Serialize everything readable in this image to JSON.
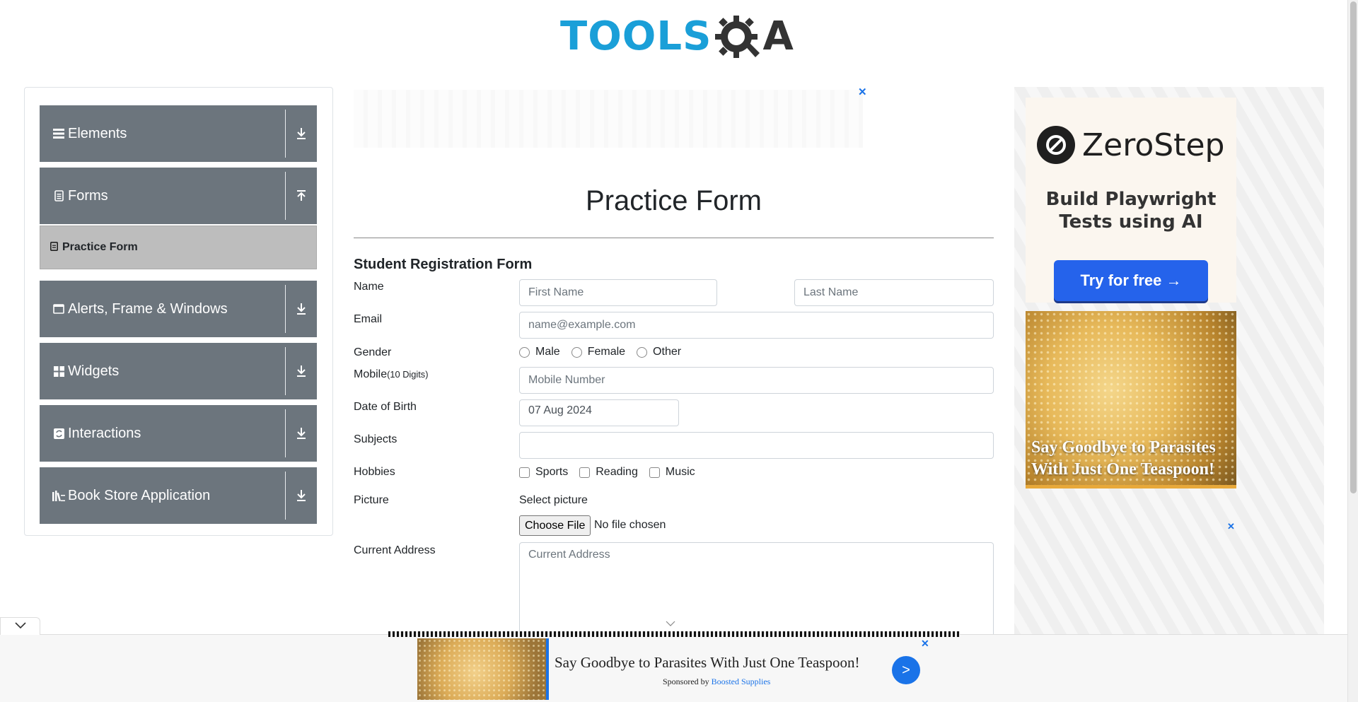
{
  "header": {
    "logo_text": "TOOLS",
    "logo_suffix": "A"
  },
  "sidebar": {
    "groups": [
      {
        "label": "Elements",
        "icon": "menu-icon",
        "toggle": "download-icon"
      },
      {
        "label": "Forms",
        "icon": "document-icon",
        "toggle": "upload-icon"
      },
      {
        "label": "Alerts, Frame & Windows",
        "icon": "window-icon",
        "toggle": "download-icon"
      },
      {
        "label": "Widgets",
        "icon": "widgets-icon",
        "toggle": "download-icon"
      },
      {
        "label": "Interactions",
        "icon": "refresh-icon",
        "toggle": "download-icon"
      },
      {
        "label": "Book Store Application",
        "icon": "library-icon",
        "toggle": "download-icon"
      }
    ],
    "active_subitem": "Practice Form"
  },
  "form": {
    "page_title": "Practice Form",
    "heading": "Student Registration Form",
    "name_label": "Name",
    "first_name_placeholder": "First Name",
    "last_name_placeholder": "Last Name",
    "email_label": "Email",
    "email_placeholder": "name@example.com",
    "gender_label": "Gender",
    "gender_options": [
      "Male",
      "Female",
      "Other"
    ],
    "mobile_label": "Mobile",
    "mobile_hint": "(10 Digits)",
    "mobile_placeholder": "Mobile Number",
    "dob_label": "Date of Birth",
    "dob_value": "07 Aug 2024",
    "subjects_label": "Subjects",
    "hobbies_label": "Hobbies",
    "hobbies_options": [
      "Sports",
      "Reading",
      "Music"
    ],
    "picture_label": "Picture",
    "select_picture": "Select picture",
    "choose_file": "Choose File",
    "no_file": "No file chosen",
    "address_label": "Current Address",
    "address_placeholder": "Current Address"
  },
  "ads": {
    "close_glyph": "✕",
    "zerostep_name": "ZeroStep",
    "zerostep_tagline_1": "Build Playwright",
    "zerostep_tagline_2": "Tests using AI",
    "zerostep_cta": "Try for free →",
    "sugar_headline": "Say Goodbye to Parasites With Just One Teaspoon!",
    "bottom_title": "Say Goodbye to Parasites With Just One Teaspoon!",
    "bottom_sponsored": "Sponsored by",
    "bottom_sponsor_name": "Boosted Supplies",
    "bottom_go": ">"
  },
  "colors": {
    "sidebar_group_bg": "#6c757d",
    "active_item_bg": "#bdbdbd",
    "logo_blue": "#1a9fd8",
    "cta_blue": "#2563eb"
  }
}
